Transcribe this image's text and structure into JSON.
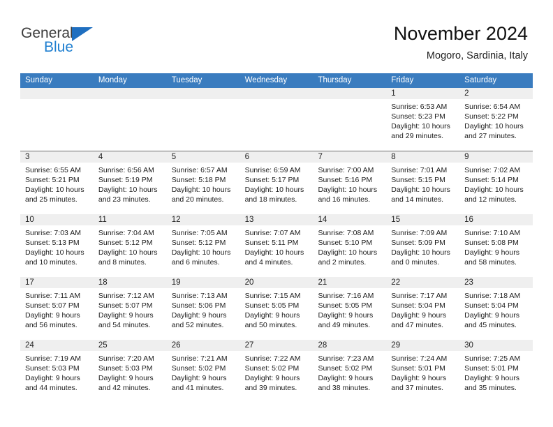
{
  "brand": {
    "name_part1": "General",
    "name_part2": "Blue",
    "triangle_icon": "blue-triangle-icon",
    "color_dark": "#3b3b3b",
    "color_blue": "#1f7fd0"
  },
  "header": {
    "title": "November 2024",
    "location": "Mogoro, Sardinia, Italy"
  },
  "theme": {
    "header_row_bg": "#3a7cbf",
    "header_row_text": "#ffffff",
    "day_band_bg": "#efefef",
    "grid_line": "#6d6d6d",
    "cell_bg": "#ffffff",
    "text": "#1c1c1c"
  },
  "weekdays": [
    "Sunday",
    "Monday",
    "Tuesday",
    "Wednesday",
    "Thursday",
    "Friday",
    "Saturday"
  ],
  "weeks": [
    [
      {
        "empty": true
      },
      {
        "empty": true
      },
      {
        "empty": true
      },
      {
        "empty": true
      },
      {
        "empty": true
      },
      {
        "day": "1",
        "sunrise": "Sunrise: 6:53 AM",
        "sunset": "Sunset: 5:23 PM",
        "daylight_1": "Daylight: 10 hours",
        "daylight_2": "and 29 minutes."
      },
      {
        "day": "2",
        "sunrise": "Sunrise: 6:54 AM",
        "sunset": "Sunset: 5:22 PM",
        "daylight_1": "Daylight: 10 hours",
        "daylight_2": "and 27 minutes."
      }
    ],
    [
      {
        "day": "3",
        "sunrise": "Sunrise: 6:55 AM",
        "sunset": "Sunset: 5:21 PM",
        "daylight_1": "Daylight: 10 hours",
        "daylight_2": "and 25 minutes."
      },
      {
        "day": "4",
        "sunrise": "Sunrise: 6:56 AM",
        "sunset": "Sunset: 5:19 PM",
        "daylight_1": "Daylight: 10 hours",
        "daylight_2": "and 23 minutes."
      },
      {
        "day": "5",
        "sunrise": "Sunrise: 6:57 AM",
        "sunset": "Sunset: 5:18 PM",
        "daylight_1": "Daylight: 10 hours",
        "daylight_2": "and 20 minutes."
      },
      {
        "day": "6",
        "sunrise": "Sunrise: 6:59 AM",
        "sunset": "Sunset: 5:17 PM",
        "daylight_1": "Daylight: 10 hours",
        "daylight_2": "and 18 minutes."
      },
      {
        "day": "7",
        "sunrise": "Sunrise: 7:00 AM",
        "sunset": "Sunset: 5:16 PM",
        "daylight_1": "Daylight: 10 hours",
        "daylight_2": "and 16 minutes."
      },
      {
        "day": "8",
        "sunrise": "Sunrise: 7:01 AM",
        "sunset": "Sunset: 5:15 PM",
        "daylight_1": "Daylight: 10 hours",
        "daylight_2": "and 14 minutes."
      },
      {
        "day": "9",
        "sunrise": "Sunrise: 7:02 AM",
        "sunset": "Sunset: 5:14 PM",
        "daylight_1": "Daylight: 10 hours",
        "daylight_2": "and 12 minutes."
      }
    ],
    [
      {
        "day": "10",
        "sunrise": "Sunrise: 7:03 AM",
        "sunset": "Sunset: 5:13 PM",
        "daylight_1": "Daylight: 10 hours",
        "daylight_2": "and 10 minutes."
      },
      {
        "day": "11",
        "sunrise": "Sunrise: 7:04 AM",
        "sunset": "Sunset: 5:12 PM",
        "daylight_1": "Daylight: 10 hours",
        "daylight_2": "and 8 minutes."
      },
      {
        "day": "12",
        "sunrise": "Sunrise: 7:05 AM",
        "sunset": "Sunset: 5:12 PM",
        "daylight_1": "Daylight: 10 hours",
        "daylight_2": "and 6 minutes."
      },
      {
        "day": "13",
        "sunrise": "Sunrise: 7:07 AM",
        "sunset": "Sunset: 5:11 PM",
        "daylight_1": "Daylight: 10 hours",
        "daylight_2": "and 4 minutes."
      },
      {
        "day": "14",
        "sunrise": "Sunrise: 7:08 AM",
        "sunset": "Sunset: 5:10 PM",
        "daylight_1": "Daylight: 10 hours",
        "daylight_2": "and 2 minutes."
      },
      {
        "day": "15",
        "sunrise": "Sunrise: 7:09 AM",
        "sunset": "Sunset: 5:09 PM",
        "daylight_1": "Daylight: 10 hours",
        "daylight_2": "and 0 minutes."
      },
      {
        "day": "16",
        "sunrise": "Sunrise: 7:10 AM",
        "sunset": "Sunset: 5:08 PM",
        "daylight_1": "Daylight: 9 hours",
        "daylight_2": "and 58 minutes."
      }
    ],
    [
      {
        "day": "17",
        "sunrise": "Sunrise: 7:11 AM",
        "sunset": "Sunset: 5:07 PM",
        "daylight_1": "Daylight: 9 hours",
        "daylight_2": "and 56 minutes."
      },
      {
        "day": "18",
        "sunrise": "Sunrise: 7:12 AM",
        "sunset": "Sunset: 5:07 PM",
        "daylight_1": "Daylight: 9 hours",
        "daylight_2": "and 54 minutes."
      },
      {
        "day": "19",
        "sunrise": "Sunrise: 7:13 AM",
        "sunset": "Sunset: 5:06 PM",
        "daylight_1": "Daylight: 9 hours",
        "daylight_2": "and 52 minutes."
      },
      {
        "day": "20",
        "sunrise": "Sunrise: 7:15 AM",
        "sunset": "Sunset: 5:05 PM",
        "daylight_1": "Daylight: 9 hours",
        "daylight_2": "and 50 minutes."
      },
      {
        "day": "21",
        "sunrise": "Sunrise: 7:16 AM",
        "sunset": "Sunset: 5:05 PM",
        "daylight_1": "Daylight: 9 hours",
        "daylight_2": "and 49 minutes."
      },
      {
        "day": "22",
        "sunrise": "Sunrise: 7:17 AM",
        "sunset": "Sunset: 5:04 PM",
        "daylight_1": "Daylight: 9 hours",
        "daylight_2": "and 47 minutes."
      },
      {
        "day": "23",
        "sunrise": "Sunrise: 7:18 AM",
        "sunset": "Sunset: 5:04 PM",
        "daylight_1": "Daylight: 9 hours",
        "daylight_2": "and 45 minutes."
      }
    ],
    [
      {
        "day": "24",
        "sunrise": "Sunrise: 7:19 AM",
        "sunset": "Sunset: 5:03 PM",
        "daylight_1": "Daylight: 9 hours",
        "daylight_2": "and 44 minutes."
      },
      {
        "day": "25",
        "sunrise": "Sunrise: 7:20 AM",
        "sunset": "Sunset: 5:03 PM",
        "daylight_1": "Daylight: 9 hours",
        "daylight_2": "and 42 minutes."
      },
      {
        "day": "26",
        "sunrise": "Sunrise: 7:21 AM",
        "sunset": "Sunset: 5:02 PM",
        "daylight_1": "Daylight: 9 hours",
        "daylight_2": "and 41 minutes."
      },
      {
        "day": "27",
        "sunrise": "Sunrise: 7:22 AM",
        "sunset": "Sunset: 5:02 PM",
        "daylight_1": "Daylight: 9 hours",
        "daylight_2": "and 39 minutes."
      },
      {
        "day": "28",
        "sunrise": "Sunrise: 7:23 AM",
        "sunset": "Sunset: 5:02 PM",
        "daylight_1": "Daylight: 9 hours",
        "daylight_2": "and 38 minutes."
      },
      {
        "day": "29",
        "sunrise": "Sunrise: 7:24 AM",
        "sunset": "Sunset: 5:01 PM",
        "daylight_1": "Daylight: 9 hours",
        "daylight_2": "and 37 minutes."
      },
      {
        "day": "30",
        "sunrise": "Sunrise: 7:25 AM",
        "sunset": "Sunset: 5:01 PM",
        "daylight_1": "Daylight: 9 hours",
        "daylight_2": "and 35 minutes."
      }
    ]
  ]
}
